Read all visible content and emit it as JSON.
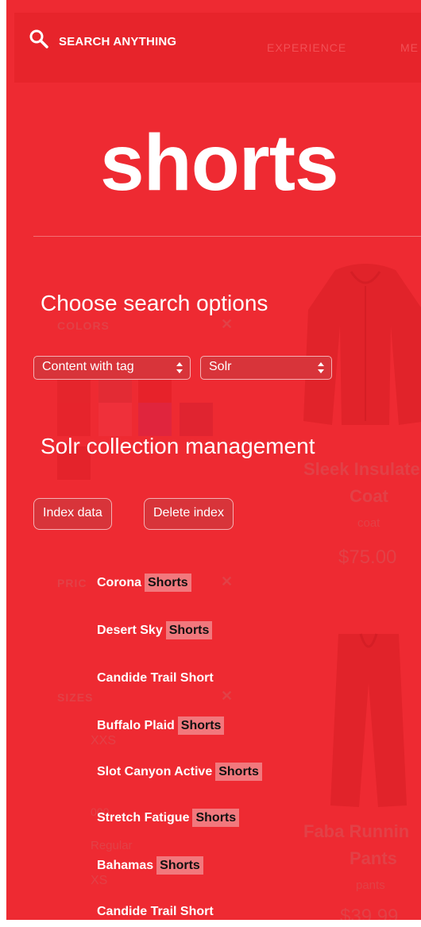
{
  "header": {
    "search_label": "SEARCH ANYTHING",
    "nav": [
      "EXPERIENCE",
      "ME"
    ]
  },
  "page_title": "shorts",
  "background": {
    "colors_label": "COLORS",
    "price_label": "PRIC",
    "sizes_label": "SIZES",
    "sizes": [
      "XXS",
      "000",
      "Regular",
      "XS"
    ],
    "products": [
      {
        "name_line1": "Sleek Insulate",
        "name_line2": "Coat",
        "category": "coat",
        "price": "$75.00"
      },
      {
        "name_line1": "Faba Runnin",
        "name_line2": "Pants",
        "category": "pants",
        "price": "$39.99"
      }
    ]
  },
  "search_options": {
    "heading": "Choose search options",
    "content_select": "Content with tag",
    "engine_select": "Solr"
  },
  "solr": {
    "heading": "Solr collection management",
    "index_button": "Index data",
    "delete_button": "Delete index"
  },
  "results": [
    {
      "name": "Corona",
      "tag": "Shorts"
    },
    {
      "name": "Desert Sky",
      "tag": "Shorts"
    },
    {
      "name": "Candide Trail Short",
      "tag": ""
    },
    {
      "name": "Buffalo Plaid",
      "tag": "Shorts"
    },
    {
      "name": "Slot Canyon Active",
      "tag": "Shorts"
    },
    {
      "name": "Stretch Fatigue",
      "tag": "Shorts"
    },
    {
      "name": "Bahamas",
      "tag": "Shorts"
    },
    {
      "name": "Candide Trail Short",
      "tag": ""
    }
  ],
  "colors": {
    "background": "#ee2a32",
    "header": "#e7242b",
    "highlight": "#f2787d"
  }
}
